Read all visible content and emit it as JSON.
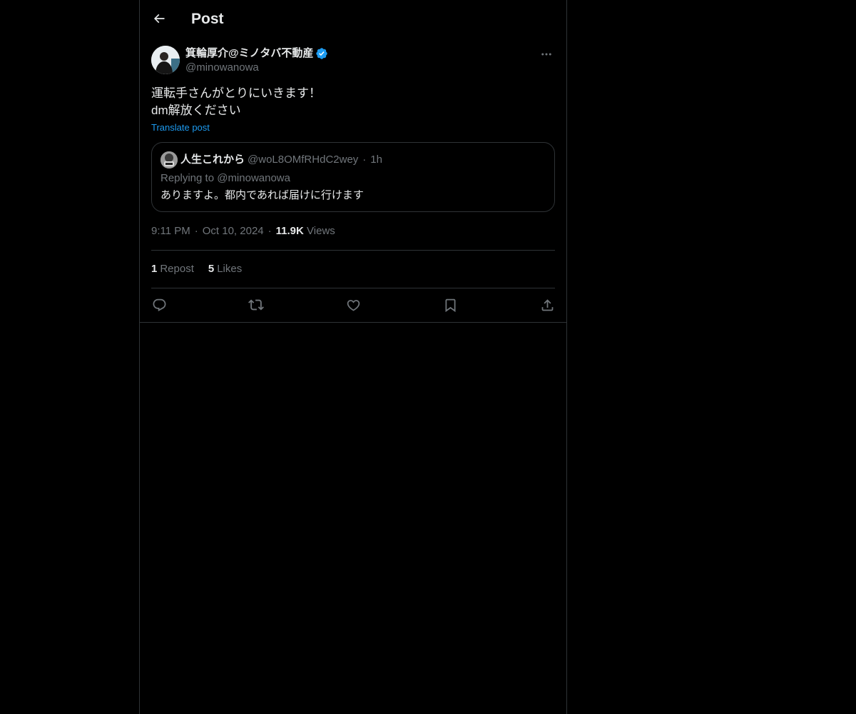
{
  "header": {
    "title": "Post"
  },
  "author": {
    "display_name": "箕輪厚介@ミノタバ不動産",
    "handle": "@minowanowa",
    "verified": true
  },
  "post": {
    "lines": [
      "運転手さんがとりにいきます！",
      "dm解放ください"
    ],
    "translate_label": "Translate post"
  },
  "quote": {
    "name": "人生これから",
    "handle": "@woL8OMfRHdC2wey",
    "dot": "·",
    "time": "1h",
    "replying_to": "Replying to @minowanowa",
    "text": "ありますよ。都内であれば届けに行けます"
  },
  "meta": {
    "time": "9:11 PM",
    "dot1": "·",
    "date": "Oct 10, 2024",
    "dot2": "·",
    "views_count": "11.9K",
    "views_label": "Views"
  },
  "stats": {
    "reposts_count": "1",
    "reposts_label": "Repost",
    "likes_count": "5",
    "likes_label": "Likes"
  },
  "colors": {
    "background": "#000000",
    "text": "#e7e9ea",
    "secondary": "#71767b",
    "accent": "#1d9bf0",
    "border": "#2f3336"
  },
  "icons": {
    "back": "back-arrow-icon",
    "more": "more-horizontal-icon",
    "verified": "verified-badge-icon",
    "reply": "reply-icon",
    "repost": "repost-icon",
    "like": "heart-icon",
    "bookmark": "bookmark-icon",
    "share": "share-icon"
  }
}
